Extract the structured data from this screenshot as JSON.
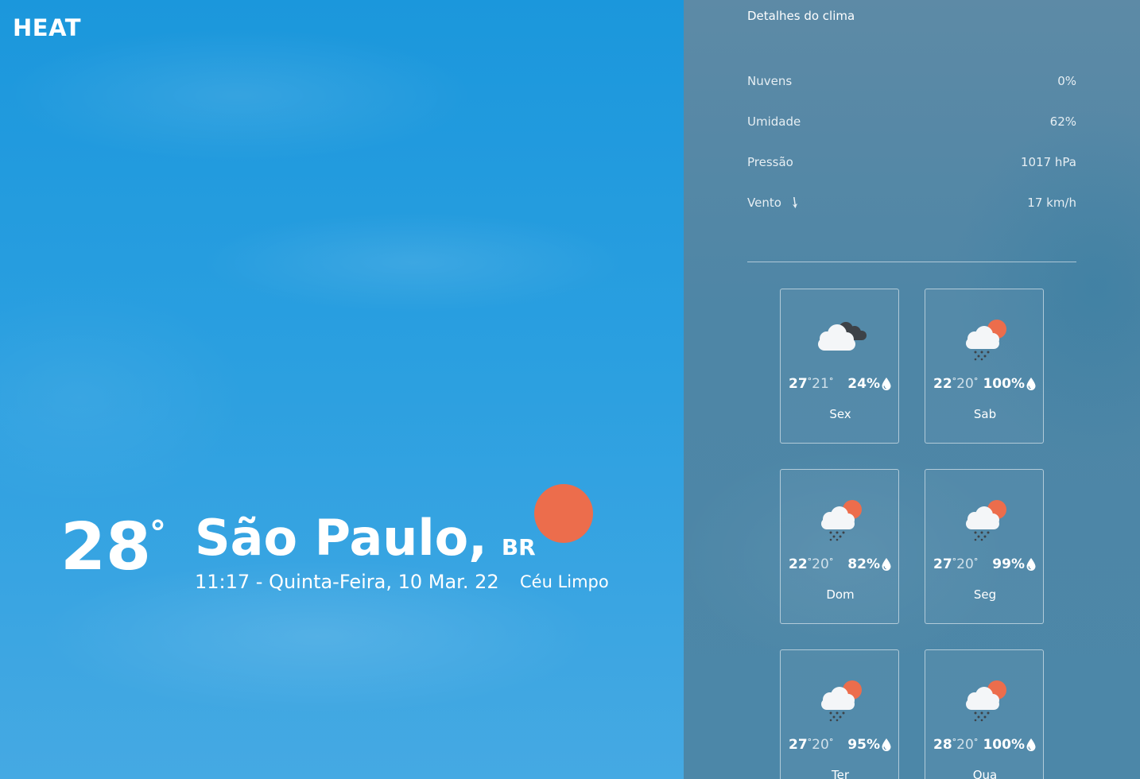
{
  "app": {
    "logo": "HEAT"
  },
  "current": {
    "temperature": "28",
    "degree_symbol": "°",
    "city": "São Paulo,",
    "country": "BR",
    "datetime": "11:17 - Quinta-Feira, 10 Mar. 22",
    "condition": "Céu Limpo",
    "condition_icon": "sun-icon"
  },
  "details": {
    "title": "Detalhes do clima",
    "rows": [
      {
        "label": "Nuvens",
        "value": "0%"
      },
      {
        "label": "Umidade",
        "value": "62%"
      },
      {
        "label": "Pressão",
        "value": "1017 hPa"
      },
      {
        "label": "Vento",
        "value": "17 km/h",
        "icon": "wind-direction-arrow-icon"
      }
    ]
  },
  "forecast": [
    {
      "day": "Sex",
      "max": "27",
      "min": "21",
      "humidity": "24%",
      "icon": "cloudy-icon"
    },
    {
      "day": "Sab",
      "max": "22",
      "min": "20",
      "humidity": "100%",
      "icon": "rain-sun-icon"
    },
    {
      "day": "Dom",
      "max": "22",
      "min": "20",
      "humidity": "82%",
      "icon": "rain-sun-icon"
    },
    {
      "day": "Seg",
      "max": "27",
      "min": "20",
      "humidity": "99%",
      "icon": "rain-sun-icon"
    },
    {
      "day": "Ter",
      "max": "27",
      "min": "20",
      "humidity": "95%",
      "icon": "rain-sun-icon"
    },
    {
      "day": "Qua",
      "max": "28",
      "min": "20",
      "humidity": "100%",
      "icon": "rain-sun-icon"
    }
  ],
  "colors": {
    "sun": "#ec6d4c",
    "sky": "#2a9fe0",
    "panel": "#4e86a6"
  }
}
